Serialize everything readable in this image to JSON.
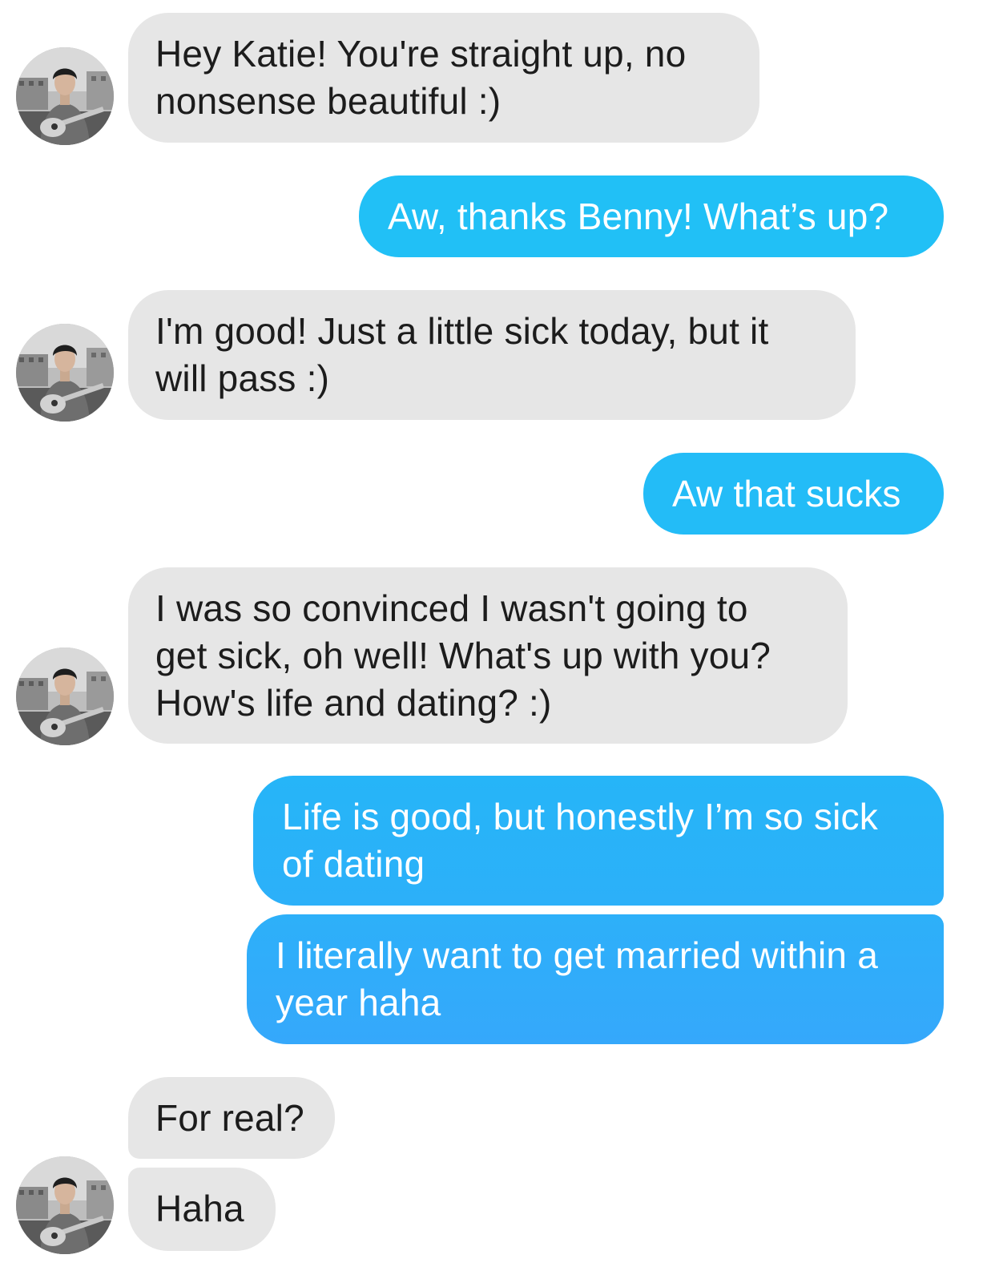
{
  "colors": {
    "incoming_bubble": "#e6e6e6",
    "outgoing_bubble_top": "#1fc4f5",
    "outgoing_bubble_bottom": "#36a6fb"
  },
  "contact": {
    "avatar_icon": "guitar-player-avatar"
  },
  "messages": [
    {
      "direction": "incoming",
      "text": "Hey Katie!  You're straight up, no\nnonsense beautiful :)"
    },
    {
      "direction": "outgoing",
      "text": "Aw, thanks Benny! What’s up?"
    },
    {
      "direction": "incoming",
      "text": "I'm good!  Just a little sick today, but it\nwill pass :)"
    },
    {
      "direction": "outgoing",
      "text": "Aw that sucks"
    },
    {
      "direction": "incoming",
      "text": "I was so convinced I wasn't going to\nget sick, oh well!  What's up with you?\nHow's life and dating? :)"
    },
    {
      "direction": "outgoing",
      "text": "Life is good, but honestly I’m so sick\nof dating"
    },
    {
      "direction": "outgoing",
      "text": "I literally want to get married within a\nyear haha"
    },
    {
      "direction": "incoming",
      "text": "For real?"
    },
    {
      "direction": "incoming",
      "text": "Haha"
    }
  ]
}
